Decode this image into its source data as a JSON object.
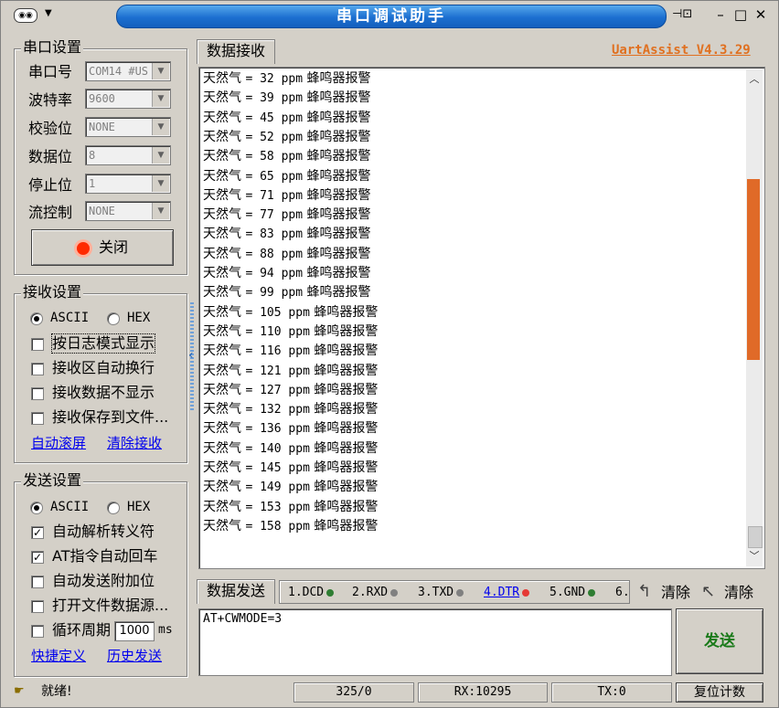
{
  "window": {
    "title": "串口调试助手",
    "version_link": "UartAssist V4.3.29"
  },
  "serial": {
    "group_title": "串口设置",
    "fields": [
      {
        "label": "串口号",
        "value": "COM14 #US"
      },
      {
        "label": "波特率",
        "value": "9600"
      },
      {
        "label": "校验位",
        "value": "NONE"
      },
      {
        "label": "数据位",
        "value": "8"
      },
      {
        "label": "停止位",
        "value": "1"
      },
      {
        "label": "流控制",
        "value": "NONE"
      }
    ],
    "close_button": "关闭"
  },
  "receive": {
    "group_title": "接收设置",
    "ascii": "ASCII",
    "hex": "HEX",
    "selected": "ASCII",
    "options": [
      {
        "label": "按日志模式显示",
        "checked": false
      },
      {
        "label": "接收区自动换行",
        "checked": false
      },
      {
        "label": "接收数据不显示",
        "checked": false
      },
      {
        "label": "接收保存到文件...",
        "checked": false
      }
    ],
    "links": [
      "自动滚屏",
      "清除接收"
    ]
  },
  "send": {
    "group_title": "发送设置",
    "ascii": "ASCII",
    "hex": "HEX",
    "selected": "ASCII",
    "options": [
      {
        "label": "自动解析转义符",
        "checked": true
      },
      {
        "label": "AT指令自动回车",
        "checked": true
      },
      {
        "label": "自动发送附加位",
        "checked": false
      },
      {
        "label": "打开文件数据源...",
        "checked": false
      }
    ],
    "cycle_label": "循环周期",
    "cycle_value": "1000",
    "cycle_unit": "ms",
    "links": [
      "快捷定义",
      "历史发送"
    ]
  },
  "receive_panel": {
    "tab": "数据接收",
    "lines": [
      {
        "prefix": "天然气",
        "value": "= 32 ppm",
        "msg": "蜂鸣器报警"
      },
      {
        "prefix": "天然气",
        "value": "= 39 ppm",
        "msg": "蜂鸣器报警"
      },
      {
        "prefix": "天然气",
        "value": "= 45 ppm",
        "msg": "蜂鸣器报警"
      },
      {
        "prefix": "天然气",
        "value": "= 52 ppm",
        "msg": "蜂鸣器报警"
      },
      {
        "prefix": "天然气",
        "value": "= 58 ppm",
        "msg": "蜂鸣器报警"
      },
      {
        "prefix": "天然气",
        "value": "= 65 ppm",
        "msg": "蜂鸣器报警"
      },
      {
        "prefix": "天然气",
        "value": "= 71 ppm",
        "msg": "蜂鸣器报警"
      },
      {
        "prefix": "天然气",
        "value": "= 77 ppm",
        "msg": "蜂鸣器报警"
      },
      {
        "prefix": "天然气",
        "value": "= 83 ppm",
        "msg": "蜂鸣器报警"
      },
      {
        "prefix": "天然气",
        "value": "= 88 ppm",
        "msg": "蜂鸣器报警"
      },
      {
        "prefix": "天然气",
        "value": "= 94 ppm",
        "msg": "蜂鸣器报警"
      },
      {
        "prefix": "天然气",
        "value": "= 99 ppm",
        "msg": "蜂鸣器报警"
      },
      {
        "prefix": "天然气",
        "value": "= 105 ppm",
        "msg": "蜂鸣器报警"
      },
      {
        "prefix": "天然气",
        "value": "= 110 ppm",
        "msg": "蜂鸣器报警"
      },
      {
        "prefix": "天然气",
        "value": "= 116 ppm",
        "msg": "蜂鸣器报警"
      },
      {
        "prefix": "天然气",
        "value": "= 121 ppm",
        "msg": "蜂鸣器报警"
      },
      {
        "prefix": "天然气",
        "value": "= 127 ppm",
        "msg": "蜂鸣器报警"
      },
      {
        "prefix": "天然气",
        "value": "= 132 ppm",
        "msg": "蜂鸣器报警"
      },
      {
        "prefix": "天然气",
        "value": "= 136 ppm",
        "msg": "蜂鸣器报警"
      },
      {
        "prefix": "天然气",
        "value": "= 140 ppm",
        "msg": "蜂鸣器报警"
      },
      {
        "prefix": "天然气",
        "value": "= 145 ppm",
        "msg": "蜂鸣器报警"
      },
      {
        "prefix": "天然气",
        "value": "= 149 ppm",
        "msg": "蜂鸣器报警"
      },
      {
        "prefix": "天然气",
        "value": "= 153 ppm",
        "msg": "蜂鸣器报警"
      },
      {
        "prefix": "天然气",
        "value": "= 158 ppm",
        "msg": "蜂鸣器报警"
      }
    ]
  },
  "send_panel": {
    "tab": "数据发送",
    "signals": [
      {
        "label": "1.DCD",
        "color": "#2e7d32"
      },
      {
        "label": "2.RXD",
        "color": "#808080"
      },
      {
        "label": "3.TXD",
        "color": "#808080"
      },
      {
        "label": "4.DTR",
        "color": "#e53935"
      },
      {
        "label": "5.GND",
        "color": "#2e7d32"
      },
      {
        "label": "6."
      }
    ],
    "clear1": "清除",
    "clear2": "清除",
    "input_value": "AT+CWMODE=3",
    "send_button": "发送"
  },
  "status": {
    "ready": "就绪!",
    "counter": "325/0",
    "rx": "RX:10295",
    "tx": "TX:0",
    "reset": "复位计数"
  },
  "colors": {
    "title_blue": "#1c6fd0",
    "accent_orange": "#e07020",
    "send_green": "#1a7a1a"
  }
}
